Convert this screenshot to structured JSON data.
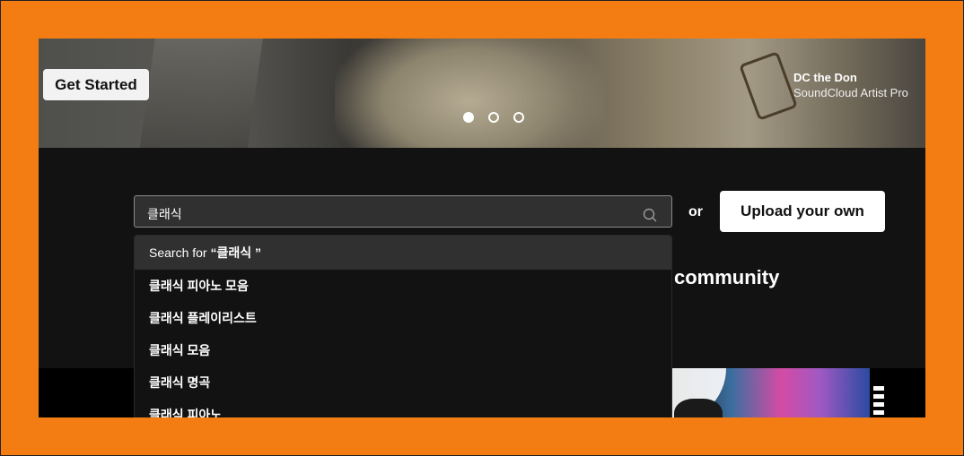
{
  "hero": {
    "get_started_label": "Get Started",
    "artist_name": "DC the Don",
    "artist_subtitle": "SoundCloud Artist Pro",
    "carousel_dots": 3,
    "active_dot": 1
  },
  "search": {
    "value": "클래식",
    "or_label": "or",
    "upload_label": "Upload your own"
  },
  "dropdown": {
    "search_for_prefix": "Search for ",
    "search_for_query": "“클래식 ”",
    "items": [
      "클래식 피아노 모음",
      "클래식 플레이리스트",
      "클래식 모음",
      "클래식 명곡",
      "클래식 피아노"
    ]
  },
  "community_text": "community",
  "colors": {
    "frame_background": "#f47d13",
    "page_background": "#121212",
    "input_background": "#303030"
  }
}
